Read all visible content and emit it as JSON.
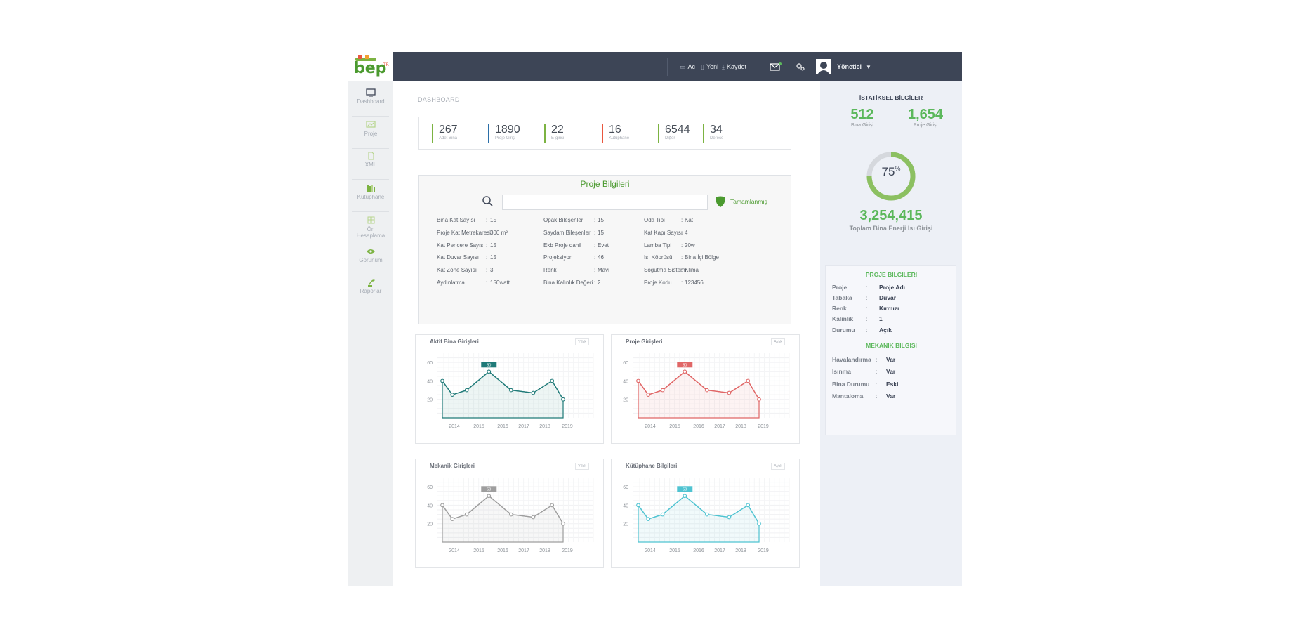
{
  "brand": {
    "logo_text": "bep",
    "logo_sup": "TR",
    "accent": "#5cb85c",
    "dark": "#3d4556"
  },
  "topbar": {
    "open_label": "Ac",
    "new_label": "Yeni",
    "save_label": "Kaydet",
    "user_label": "Yönetici"
  },
  "sidebar": {
    "items": [
      {
        "label": "Dashboard",
        "icon": "monitor-icon"
      },
      {
        "label": "Proje",
        "icon": "presentation-icon"
      },
      {
        "label": "XML",
        "icon": "file-icon"
      },
      {
        "label": "Kütüphane",
        "icon": "books-icon"
      },
      {
        "label": "Ön Hesaplama",
        "icon": "grid-icon"
      },
      {
        "label": "Görünüm",
        "icon": "eye-icon"
      },
      {
        "label": "Raporlar",
        "icon": "plant-icon"
      }
    ]
  },
  "breadcrumb": "DASHBOARD",
  "stats": [
    {
      "value": "267",
      "label": "Adet Bina",
      "color": "#7cb342"
    },
    {
      "value": "1890",
      "label": "Proje Girişi",
      "color": "#2b6fa8"
    },
    {
      "value": "22",
      "label": "E-girişi",
      "color": "#7cb342"
    },
    {
      "value": "16",
      "label": "Kütüphane",
      "color": "#e9573f"
    },
    {
      "value": "6544",
      "label": "Diğer",
      "color": "#7cb342"
    },
    {
      "value": "34",
      "label": "Derece",
      "color": "#7cb342"
    }
  ],
  "project": {
    "title": "Proje Bilgileri",
    "search_placeholder": "",
    "status": "Tamamlanmış",
    "columns": [
      [
        {
          "k": "Bina Kat Sayısı",
          "v": "15"
        },
        {
          "k": "Proje Kat Metrekaresi",
          "v": "300 m²"
        },
        {
          "k": "Kat Pencere Sayısı",
          "v": "15"
        },
        {
          "k": "Kat Duvar Sayısı",
          "v": "15"
        },
        {
          "k": "Kat Zone Sayısı",
          "v": "3"
        },
        {
          "k": "Aydınlatma",
          "v": "150watt"
        }
      ],
      [
        {
          "k": "Opak Bileşenler",
          "v": "15"
        },
        {
          "k": "Saydam Bileşenler",
          "v": "15"
        },
        {
          "k": "Ekb Proje dahil",
          "v": "Evet"
        },
        {
          "k": "Projeksiyon",
          "v": "46"
        },
        {
          "k": "Renk",
          "v": "Mavi"
        },
        {
          "k": "Bina Kalınlık Değeri",
          "v": "2"
        }
      ],
      [
        {
          "k": "Oda Tipi",
          "v": "Kat"
        },
        {
          "k": "Kat Kapı Sayısı",
          "v": "4"
        },
        {
          "k": "Lamba Tipi",
          "v": "20w"
        },
        {
          "k": "Isı Köprüsü",
          "v": "Bina İçi Bölge"
        },
        {
          "k": "Soğutma Sistemi",
          "v": "Klima"
        },
        {
          "k": "Proje Kodu",
          "v": "123456"
        }
      ]
    ]
  },
  "chart_data": [
    {
      "type": "area",
      "title": "Aktif Bina Girişleri",
      "badge": "Yıllık",
      "x_ticks": [
        "2014",
        "2015",
        "2016",
        "2017",
        "2018",
        "2019"
      ],
      "y_ticks": [
        "20",
        "40",
        "60"
      ],
      "ylim": [
        0,
        60
      ],
      "values": [
        40,
        25,
        30,
        50,
        30,
        27,
        40,
        20
      ],
      "x_positions": [
        2013.75,
        2014.2,
        2014.85,
        2015.85,
        2016.85,
        2017.85,
        2018.7,
        2019.2
      ],
      "highlight": {
        "index": 3,
        "label": "50"
      },
      "color": "#1f7a78"
    },
    {
      "type": "area",
      "title": "Proje Girişleri",
      "badge": "Aylık",
      "x_ticks": [
        "2014",
        "2015",
        "2016",
        "2017",
        "2018",
        "2019"
      ],
      "y_ticks": [
        "20",
        "40",
        "60"
      ],
      "ylim": [
        0,
        60
      ],
      "values": [
        40,
        25,
        30,
        50,
        30,
        27,
        40,
        20
      ],
      "x_positions": [
        2013.75,
        2014.2,
        2014.85,
        2015.85,
        2016.85,
        2017.85,
        2018.7,
        2019.2
      ],
      "highlight": {
        "index": 3,
        "label": "50"
      },
      "color": "#e06666"
    },
    {
      "type": "area",
      "title": "Mekanik Girişleri",
      "badge": "Yıllık",
      "x_ticks": [
        "2014",
        "2015",
        "2016",
        "2017",
        "2018",
        "2019"
      ],
      "y_ticks": [
        "20",
        "40",
        "60"
      ],
      "ylim": [
        0,
        60
      ],
      "values": [
        40,
        25,
        30,
        50,
        30,
        27,
        40,
        20
      ],
      "x_positions": [
        2013.75,
        2014.2,
        2014.85,
        2015.85,
        2016.85,
        2017.85,
        2018.7,
        2019.2
      ],
      "highlight": {
        "index": 3,
        "label": "50"
      },
      "color": "#9e9e9e"
    },
    {
      "type": "area",
      "title": "Kütüphane Bilgileri",
      "badge": "Aylık",
      "x_ticks": [
        "2014",
        "2015",
        "2016",
        "2017",
        "2018",
        "2019"
      ],
      "y_ticks": [
        "20",
        "40",
        "60"
      ],
      "ylim": [
        0,
        60
      ],
      "values": [
        40,
        25,
        30,
        50,
        30,
        27,
        40,
        20
      ],
      "x_positions": [
        2013.75,
        2014.2,
        2014.85,
        2015.85,
        2016.85,
        2017.85,
        2018.7,
        2019.2
      ],
      "highlight": {
        "index": 3,
        "label": "50"
      },
      "color": "#4fc3d1"
    }
  ],
  "right_panel": {
    "title": "İSTATİKSEL BİLGİLER",
    "bina_value": "512",
    "bina_label": "Bina Girişi",
    "proje_value": "1,654",
    "proje_label": "Proje Girişi",
    "progress_value": "75",
    "progress_unit": "%",
    "progress_fraction": 0.75,
    "energy_value": "3,254,415",
    "energy_label": "Toplam Bina Enerji Isı  Girişi",
    "project_box_title": "PROJE BİLGİLERİ",
    "project_rows": [
      {
        "k": "Proje",
        "v": "Proje Adı"
      },
      {
        "k": "Tabaka",
        "v": "Duvar"
      },
      {
        "k": "Renk",
        "v": "Kırmızı"
      },
      {
        "k": "Kalınlık",
        "v": "1"
      },
      {
        "k": "Durumu",
        "v": "Açık"
      }
    ],
    "mech_box_title": "MEKANİK BİLGİSİ",
    "mech_rows": [
      {
        "k": "Havalandırma",
        "v": "Var"
      },
      {
        "k": "Isınma",
        "v": "Var"
      },
      {
        "k": "Bina Durumu",
        "v": "Eski"
      },
      {
        "k": "Mantaloma",
        "v": "Var"
      }
    ],
    "separator": ":"
  }
}
